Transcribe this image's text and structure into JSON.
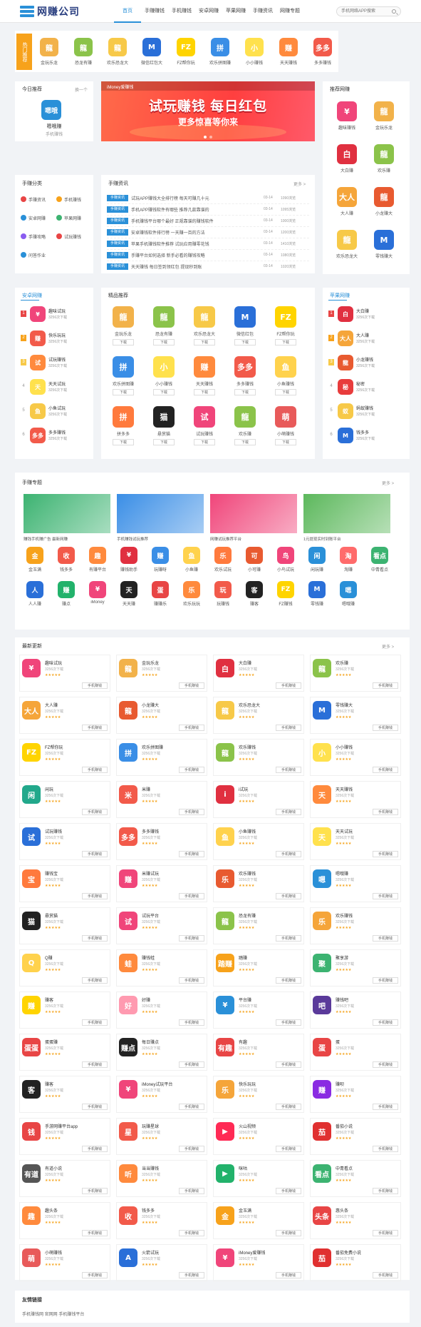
{
  "site": {
    "name": "网赚公司",
    "search_placeholder": "手机网络APP搜索"
  },
  "nav": [
    "首页",
    "手赚赚钱",
    "手机赚钱",
    "安卓网赚",
    "苹果网赚",
    "手赚资讯",
    "网赚专题"
  ],
  "hot": {
    "label": "热门推荐",
    "apps": [
      {
        "name": "金玩乐龙",
        "color": "#f2b24a",
        "icon": "龍"
      },
      {
        "name": "恐龙有赚",
        "color": "#8bc34a",
        "icon": "龍"
      },
      {
        "name": "欢乐恐龙大",
        "color": "#f7c948",
        "icon": "龍"
      },
      {
        "name": "微信红包大",
        "color": "#2a6fd8",
        "icon": "M"
      },
      {
        "name": "FZ帮你玩",
        "color": "#ffd400",
        "icon": "FZ"
      },
      {
        "name": "欢乐拼图赚",
        "color": "#3a8ee6",
        "icon": "拼"
      },
      {
        "name": "小小赚钱",
        "color": "#ffe14d",
        "icon": "小"
      },
      {
        "name": "天天赚钱",
        "color": "#ff8a3d",
        "icon": "赚"
      },
      {
        "name": "多多赚钱",
        "color": "#f25a4a",
        "icon": "多多"
      }
    ]
  },
  "today": {
    "title": "今日推荐",
    "more": "换一个",
    "app": "嗯哦赚",
    "app_icon": "嗯哦",
    "app_sub": "手机赚钱"
  },
  "banner": {
    "brand": "iMoney爱赚钱",
    "title": "试玩赚钱 每日红包",
    "sub": "更多惊喜等你来"
  },
  "recommend": {
    "title": "推荐网赚",
    "apps": [
      {
        "name": "趣味赚钱",
        "color": "#f0457a",
        "icon": "¥"
      },
      {
        "name": "金玩乐龙",
        "color": "#f2b24a",
        "icon": "龍"
      },
      {
        "name": "大白赚",
        "color": "#e03040",
        "icon": "白"
      },
      {
        "name": "欢乐赚",
        "color": "#8bc34a",
        "icon": "龍"
      },
      {
        "name": "大人赚",
        "color": "#f5a53a",
        "icon": "大人"
      },
      {
        "name": "小龙赚大",
        "color": "#e85a30",
        "icon": "龍"
      },
      {
        "name": "欢乐恐龙大",
        "color": "#f7c948",
        "icon": "龍"
      },
      {
        "name": "零钱赚大",
        "color": "#2a6fd8",
        "icon": "M"
      }
    ]
  },
  "category": {
    "title": "手赚分类",
    "items": [
      "手赚资讯",
      "手机赚钱",
      "安卓网赚",
      "苹果网赚",
      "手赚攻略",
      "试玩赚钱",
      "问答作业"
    ],
    "colors": [
      "#e84545",
      "#f7a21b",
      "#2a90d8",
      "#3cb371",
      "#8a5cf0",
      "#e84545",
      "#2a90d8"
    ]
  },
  "news": {
    "title": "手赚资讯",
    "more": "更多 >",
    "tag": "手赚资讯",
    "rows": [
      {
        "t": "试玩APP赚钱大全排行榜 每天可赚几十元",
        "d": "03-14",
        "v": "1090浏览"
      },
      {
        "t": "手机APP赚钱软件有哪些 推荐几款靠谱的",
        "d": "03-14",
        "v": "1095浏览"
      },
      {
        "t": "手机赚钱平台哪个最好 正规靠谱的赚钱软件",
        "d": "03-14",
        "v": "1000浏览"
      },
      {
        "t": "安卓赚钱软件排行榜 一天赚一百的方法",
        "d": "03-14",
        "v": "1200浏览"
      },
      {
        "t": "苹果手机赚钱软件推荐 试玩应用赚零花钱",
        "d": "03-14",
        "v": "1410浏览"
      },
      {
        "t": "手赚平台如何选择 新手必看的赚钱攻略",
        "d": "03-14",
        "v": "1080浏览"
      },
      {
        "t": "天天赚钱 每日签到领红包 提现秒到账",
        "d": "03-14",
        "v": "1020浏览"
      }
    ]
  },
  "android_rank": {
    "title": "安卓网赚",
    "items": [
      {
        "n": "趣味试玩",
        "s": "3256次下载",
        "c": "#f0457a",
        "i": "¥"
      },
      {
        "n": "快乐玩玩",
        "s": "3256次下载",
        "c": "#f25a4a",
        "i": "赚"
      },
      {
        "n": "试玩赚钱",
        "s": "3256次下载",
        "c": "#ff8a3d",
        "i": "试"
      },
      {
        "n": "天天试玩",
        "s": "3256次下载",
        "c": "#ffe14d",
        "i": "天"
      },
      {
        "n": "小鱼试玩",
        "s": "3256次下载",
        "c": "#f7c948",
        "i": "鱼"
      },
      {
        "n": "多多赚钱",
        "s": "3256次下载",
        "c": "#f25a4a",
        "i": "多多"
      }
    ]
  },
  "featured": {
    "title": "精品推荐",
    "btn": "下载",
    "apps": [
      {
        "n": "金玩乐龙",
        "c": "#f2b24a",
        "i": "龍"
      },
      {
        "n": "恐龙有赚",
        "c": "#8bc34a",
        "i": "龍"
      },
      {
        "n": "欢乐恐龙大",
        "c": "#f7c948",
        "i": "龍"
      },
      {
        "n": "微信红包",
        "c": "#2a6fd8",
        "i": "M"
      },
      {
        "n": "FZ帮你玩",
        "c": "#ffd400",
        "i": "FZ"
      },
      {
        "n": "欢乐拼图赚",
        "c": "#3a8ee6",
        "i": "拼"
      },
      {
        "n": "小小赚钱",
        "c": "#ffe14d",
        "i": "小"
      },
      {
        "n": "天天赚钱",
        "c": "#ff8a3d",
        "i": "赚"
      },
      {
        "n": "多多赚钱",
        "c": "#f25a4a",
        "i": "多多"
      },
      {
        "n": "小鱼赚钱",
        "c": "#ffd24d",
        "i": "鱼"
      },
      {
        "n": "拼多多",
        "c": "#ff7a3d",
        "i": "拼"
      },
      {
        "n": "悬赏猫",
        "c": "#222222",
        "i": "猫"
      },
      {
        "n": "试玩赚钱",
        "c": "#f0457a",
        "i": "试"
      },
      {
        "n": "欢乐赚",
        "c": "#8bc34a",
        "i": "龍"
      },
      {
        "n": "小萌赚钱",
        "c": "#e85a5a",
        "i": "萌"
      }
    ]
  },
  "ios_rank": {
    "title": "苹果网赚",
    "items": [
      {
        "n": "大白赚",
        "s": "3256次下载",
        "c": "#e03040",
        "i": "白"
      },
      {
        "n": "大人赚",
        "s": "3256次下载",
        "c": "#f5a53a",
        "i": "大人"
      },
      {
        "n": "小龙赚钱",
        "s": "3256次下载",
        "c": "#e85a30",
        "i": "龍"
      },
      {
        "n": "秘密",
        "s": "3256次下载",
        "c": "#e83c3c",
        "i": "秘"
      },
      {
        "n": "蚂蚁赚钱",
        "s": "3256次下载",
        "c": "#f7c948",
        "i": "蚁"
      },
      {
        "n": "钱多多",
        "s": "3256次下载",
        "c": "#2a6fd8",
        "i": "M"
      }
    ]
  },
  "topics": {
    "title": "手赚专题",
    "more": "更多 >",
    "items": [
      {
        "t": "赚钱手机赚广告 最新网赚",
        "c": "#3cb371"
      },
      {
        "t": "手机赚钱试玩推荐",
        "c": "#3a8ee6"
      },
      {
        "t": "网赚试玩推荐平台",
        "c": "#f0457a"
      },
      {
        "t": "1元提现实时到账平台",
        "c": "#5cb85c"
      }
    ],
    "apps": [
      {
        "n": "金玉满",
        "c": "#f7a21b",
        "i": "金"
      },
      {
        "n": "钱多多",
        "c": "#f25a4a",
        "i": "收"
      },
      {
        "n": "有赚平台",
        "c": "#ff8a3d",
        "i": "趣"
      },
      {
        "n": "赚钱助手",
        "c": "#e03040",
        "i": "¥"
      },
      {
        "n": "玩赚呀",
        "c": "#3a8ee6",
        "i": "赚"
      },
      {
        "n": "小鱼赚",
        "c": "#ffd24d",
        "i": "鱼"
      },
      {
        "n": "欢乐试玩",
        "c": "#ff7a3d",
        "i": "乐"
      },
      {
        "n": "小可赚",
        "c": "#e85a30",
        "i": "可"
      },
      {
        "n": "小鸟试玩",
        "c": "#f0457a",
        "i": "鸟"
      },
      {
        "n": "闲玩赚",
        "c": "#2a90d8",
        "i": "闲"
      },
      {
        "n": "淘赚",
        "c": "#ff6b6b",
        "i": "淘"
      },
      {
        "n": "中青看点",
        "c": "#3cb371",
        "i": "看点"
      },
      {
        "n": "人人赚",
        "c": "#2a6fd8",
        "i": "人"
      },
      {
        "n": "赚点",
        "c": "#22b26b",
        "i": "赚"
      },
      {
        "n": "iMoney",
        "c": "#f0457a",
        "i": "¥"
      },
      {
        "n": "天天赚",
        "c": "#222222",
        "i": "天"
      },
      {
        "n": "赚赚乐",
        "c": "#e84545",
        "i": "蛋"
      },
      {
        "n": "欢乐玩玩",
        "c": "#ff8a3d",
        "i": "乐"
      },
      {
        "n": "玩赚钱",
        "c": "#f25a4a",
        "i": "玩"
      },
      {
        "n": "赚客",
        "c": "#222222",
        "i": "客"
      },
      {
        "n": "FZ赚钱",
        "c": "#ffd400",
        "i": "FZ"
      },
      {
        "n": "零钱赚",
        "c": "#2a6fd8",
        "i": "M"
      },
      {
        "n": "嗯哦赚",
        "c": "#2a90d8",
        "i": "嗯"
      }
    ]
  },
  "latest": {
    "title": "最新更新",
    "more": "更多 >",
    "meta": "3256次下载",
    "tag_btn": "手机赚钱",
    "apps": [
      {
        "n": "趣味试玩",
        "c": "#f0457a",
        "i": "¥"
      },
      {
        "n": "金玩乐龙",
        "c": "#f2b24a",
        "i": "龍"
      },
      {
        "n": "大白赚",
        "c": "#e03040",
        "i": "白"
      },
      {
        "n": "欢乐赚",
        "c": "#8bc34a",
        "i": "龍"
      },
      {
        "n": "大人赚",
        "c": "#f5a53a",
        "i": "大人"
      },
      {
        "n": "小龙赚大",
        "c": "#e85a30",
        "i": "龍"
      },
      {
        "n": "欢乐恐龙大",
        "c": "#f7c948",
        "i": "龍"
      },
      {
        "n": "零钱赚大",
        "c": "#2a6fd8",
        "i": "M"
      },
      {
        "n": "FZ帮你玩",
        "c": "#ffd400",
        "i": "FZ"
      },
      {
        "n": "欢乐拼图赚",
        "c": "#3a8ee6",
        "i": "拼"
      },
      {
        "n": "欢乐赚钱",
        "c": "#8bc34a",
        "i": "龍"
      },
      {
        "n": "小小赚钱",
        "c": "#ffe14d",
        "i": "小"
      },
      {
        "n": "闲玩",
        "c": "#22a88b",
        "i": "闲"
      },
      {
        "n": "米赚",
        "c": "#f25a4a",
        "i": "米"
      },
      {
        "n": "i试玩",
        "c": "#e03040",
        "i": "i"
      },
      {
        "n": "天天赚钱",
        "c": "#ff8a3d",
        "i": "天"
      },
      {
        "n": "试玩赚钱",
        "c": "#2a6fd8",
        "i": "试"
      },
      {
        "n": "多多赚钱",
        "c": "#f25a4a",
        "i": "多多"
      },
      {
        "n": "小鱼赚钱",
        "c": "#ffd24d",
        "i": "鱼"
      },
      {
        "n": "天天试玩",
        "c": "#ffe14d",
        "i": "天"
      },
      {
        "n": "赚钱宝",
        "c": "#ff7a3d",
        "i": "宝"
      },
      {
        "n": "米赚试玩",
        "c": "#f0457a",
        "i": "赚"
      },
      {
        "n": "欢乐赚钱",
        "c": "#e85a30",
        "i": "乐"
      },
      {
        "n": "嗯哦赚",
        "c": "#2a90d8",
        "i": "嗯"
      },
      {
        "n": "悬赏猫",
        "c": "#222222",
        "i": "猫"
      },
      {
        "n": "试玩平台",
        "c": "#f0457a",
        "i": "试"
      },
      {
        "n": "恐龙有赚",
        "c": "#8bc34a",
        "i": "龍"
      },
      {
        "n": "欢乐赚钱",
        "c": "#f5a53a",
        "i": "乐"
      },
      {
        "n": "Q赚",
        "c": "#ffd24d",
        "i": "Q"
      },
      {
        "n": "赚钱蛙",
        "c": "#ff8a3d",
        "i": "蛙"
      },
      {
        "n": "踏赚",
        "c": "#f7a21b",
        "i": "踏赚"
      },
      {
        "n": "聚享游",
        "c": "#3cb371",
        "i": "聚"
      },
      {
        "n": "赚客",
        "c": "#ffd400",
        "i": "赚"
      },
      {
        "n": "好赚",
        "c": "#ff9ab0",
        "i": "好"
      },
      {
        "n": "平台赚",
        "c": "#2a90d8",
        "i": "¥"
      },
      {
        "n": "赚钱吧",
        "c": "#5a3a9a",
        "i": "吧"
      },
      {
        "n": "蛋蛋赚",
        "c": "#e84545",
        "i": "蛋蛋"
      },
      {
        "n": "每日赚点",
        "c": "#222222",
        "i": "赚点"
      },
      {
        "n": "有趣",
        "c": "#e84545",
        "i": "有趣"
      },
      {
        "n": "蛋",
        "c": "#e84545",
        "i": "蛋"
      },
      {
        "n": "赚客",
        "c": "#222222",
        "i": "客"
      },
      {
        "n": "iMoney试玩平台",
        "c": "#f0457a",
        "i": "¥"
      },
      {
        "n": "快乐玩玩",
        "c": "#f5a53a",
        "i": "乐"
      },
      {
        "n": "赚呗",
        "c": "#8a2be2",
        "i": "赚"
      },
      {
        "n": "手游网赚平台app",
        "c": "#e84545",
        "i": "钱"
      },
      {
        "n": "玩赚星球",
        "c": "#f25a4a",
        "i": "星"
      },
      {
        "n": "火山视频",
        "c": "#ff2a55",
        "i": "▶"
      },
      {
        "n": "番茄小说",
        "c": "#e03030",
        "i": "茄"
      },
      {
        "n": "有道小说",
        "c": "#555555",
        "i": "有道"
      },
      {
        "n": "当当赚钱",
        "c": "#ff8a3d",
        "i": "听"
      },
      {
        "n": "咪咕",
        "c": "#22b26b",
        "i": "▶"
      },
      {
        "n": "中青看点",
        "c": "#3cb371",
        "i": "看点"
      },
      {
        "n": "趣头条",
        "c": "#ff8a3d",
        "i": "趣"
      },
      {
        "n": "钱多多",
        "c": "#f25a4a",
        "i": "收"
      },
      {
        "n": "金玉满",
        "c": "#f7a21b",
        "i": "金"
      },
      {
        "n": "惠头条",
        "c": "#e84545",
        "i": "头条"
      },
      {
        "n": "小萌赚钱",
        "c": "#e85a5a",
        "i": "萌"
      },
      {
        "n": "火箭试玩",
        "c": "#2a6fd8",
        "i": "A"
      },
      {
        "n": "iMoney爱赚钱",
        "c": "#f0457a",
        "i": "¥"
      },
      {
        "n": "番茄免费小说",
        "c": "#e03030",
        "i": "茄"
      }
    ]
  },
  "friends": {
    "title": "友情链接",
    "links": "手机赚钱网  官网网  手机赚钱平台"
  }
}
